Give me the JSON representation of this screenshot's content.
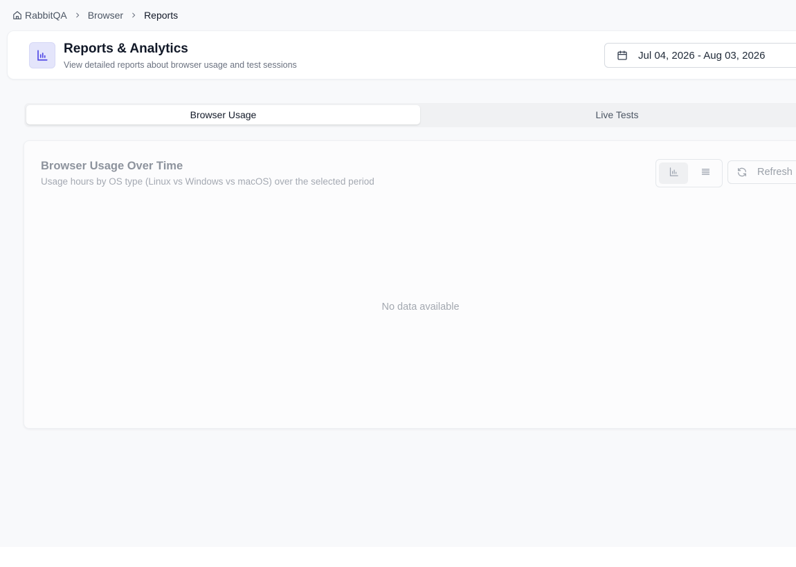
{
  "breadcrumb": {
    "items": [
      {
        "label": "RabbitQA"
      },
      {
        "label": "Browser"
      },
      {
        "label": "Reports"
      }
    ]
  },
  "header": {
    "title": "Reports & Analytics",
    "subtitle": "View detailed reports about browser usage and test sessions",
    "icon": "bar-chart-icon",
    "date_range": "Jul 04, 2026 - Aug 03, 2026"
  },
  "tabs": [
    {
      "label": "Browser Usage",
      "active": true
    },
    {
      "label": "Live Tests",
      "active": false
    }
  ],
  "chart_panel": {
    "title": "Browser Usage Over Time",
    "subtitle": "Usage hours by OS type (Linux vs Windows vs macOS) over the selected period",
    "view_toggle": {
      "selected": "chart",
      "options": [
        "chart-view-icon",
        "list-view-icon"
      ]
    },
    "refresh_label": "Refresh",
    "empty_message": "No data available"
  },
  "colors": {
    "accent": "#4f46e5",
    "accent_bg": "#e4e5fb",
    "page_bg": "#f8f9fb",
    "muted_text": "#a3a8b0"
  }
}
